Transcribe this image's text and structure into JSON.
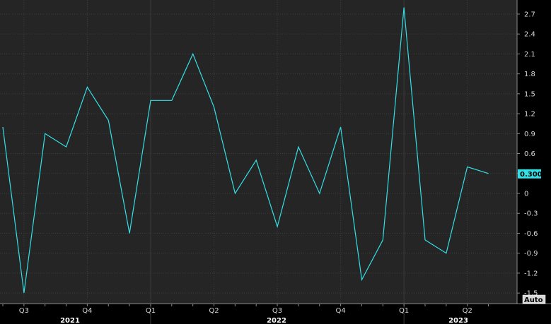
{
  "chart_data": {
    "type": "line",
    "series": [
      {
        "color": "#33e0e6",
        "x": [
          "2021-06",
          "2021-07",
          "2021-08",
          "2021-09",
          "2021-10",
          "2021-11",
          "2021-12",
          "2022-01",
          "2022-02",
          "2022-03",
          "2022-04",
          "2022-05",
          "2022-06",
          "2022-07",
          "2022-08",
          "2022-09",
          "2022-10",
          "2022-11",
          "2022-12",
          "2023-01",
          "2023-02",
          "2023-03",
          "2023-04",
          "2023-05"
        ],
        "values": [
          1.0,
          -1.5,
          0.9,
          0.7,
          1.6,
          1.1,
          -0.6,
          1.4,
          1.4,
          2.1,
          1.3,
          0.0,
          0.5,
          -0.5,
          0.7,
          0.0,
          1.0,
          -1.3,
          -0.7,
          2.8,
          -0.7,
          -0.9,
          0.4,
          0.3
        ]
      }
    ],
    "last_value_label": "0.300",
    "ylim": [
      -1.6,
      2.9
    ],
    "yticks": [
      "2.7",
      "2.4",
      "2.1",
      "1.8",
      "1.5",
      "1.2",
      "0.9",
      "0.6",
      "0.3",
      "0",
      "-0.3",
      "-0.6",
      "-0.9",
      "-1.2",
      "-1.5"
    ],
    "ytick_values": [
      2.7,
      2.4,
      2.1,
      1.8,
      1.5,
      1.2,
      0.9,
      0.6,
      0.3,
      0,
      -0.3,
      -0.6,
      -0.9,
      -1.2,
      -1.5
    ],
    "quarter_labels": [
      "Q3",
      "Q4",
      "Q1",
      "Q2",
      "Q3",
      "Q4",
      "Q1",
      "Q2"
    ],
    "year_labels": [
      "2021",
      "2022",
      "2023"
    ],
    "scale_button": "Auto",
    "grid": true,
    "colors": {
      "background": "#000000",
      "plot_background": "#252525",
      "grid": "#3e3e3e",
      "line": "#33e0e6",
      "value_box": "#33e0e6"
    }
  }
}
